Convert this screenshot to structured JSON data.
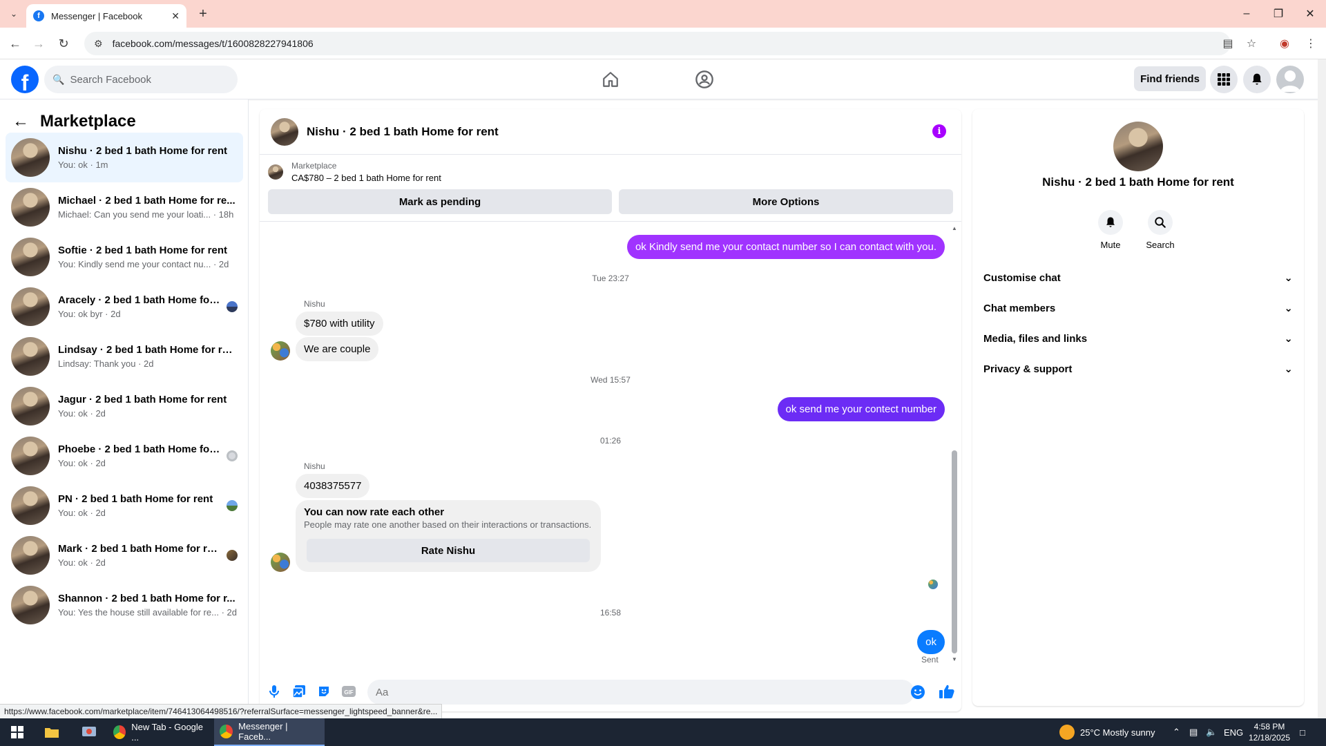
{
  "browser": {
    "tab_title": "Messenger | Facebook",
    "url": "facebook.com/messages/t/1600828227941806",
    "status_url": "https://www.facebook.com/marketplace/item/746413064498516/?referralSurface=messenger_lightspeed_banner&re..."
  },
  "fbnav": {
    "search_placeholder": "Search Facebook",
    "find_friends": "Find friends",
    "brand_color": "#0866ff"
  },
  "sidebar": {
    "title": "Marketplace",
    "conversations": [
      {
        "name": "Nishu · 2 bed 1 bath Home for rent",
        "preview": "You: ok · 1m"
      },
      {
        "name": "Michael · 2 bed 1 bath Home for re...",
        "preview": "Michael: Can you send me your loati... · 18h"
      },
      {
        "name": "Softie · 2 bed 1 bath Home for rent",
        "preview": "You: Kindly send me your contact nu... · 2d"
      },
      {
        "name": "Aracely · 2 bed 1 bath Home for ...",
        "preview": "You: ok byr · 2d"
      },
      {
        "name": "Lindsay · 2 bed 1 bath Home for rent",
        "preview": "Lindsay: Thank you · 2d"
      },
      {
        "name": "Jagur · 2 bed 1 bath Home for rent",
        "preview": "You: ok · 2d"
      },
      {
        "name": "Phoebe · 2 bed 1 bath Home for...",
        "preview": "You: ok · 2d"
      },
      {
        "name": "PN · 2 bed 1 bath Home for rent",
        "preview": "You: ok · 2d"
      },
      {
        "name": "Mark · 2 bed 1 bath Home for rent",
        "preview": "You: ok · 2d"
      },
      {
        "name": "Shannon · 2 bed 1 bath Home for r...",
        "preview": "You: Yes the house still available for re... · 2d"
      }
    ]
  },
  "chat": {
    "title": "Nishu · 2 bed 1 bath Home for rent",
    "listing_label": "Marketplace",
    "listing_detail": "CA$780 – 2 bed 1 bath Home for rent",
    "mark_pending": "Mark as pending",
    "more_options": "More Options",
    "msg1": "ok Kindly  send me your contact number so I can contact with you.",
    "ts1": "Tue 23:27",
    "sender1": "Nishu",
    "msg2": "$780 with utility",
    "msg3": "We are couple",
    "ts2": "Wed 15:57",
    "msg4": "ok send me your contect number",
    "ts3": "01:26",
    "sender2": "Nishu",
    "msg5": "4038375577",
    "rate_title": "You can now rate each other",
    "rate_sub": "People may rate one another based on their interactions or transactions.",
    "rate_button": "Rate Nishu",
    "ts4": "16:58",
    "msg6": "ok",
    "sent": "Sent",
    "composer_placeholder": "Aa",
    "out_color_1": "#a033ff",
    "out_color_2": "#6c2cf5",
    "out_color_3": "#0a7cff"
  },
  "info": {
    "name": "Nishu · 2 bed 1 bath Home for rent",
    "mute": "Mute",
    "search": "Search",
    "rows": [
      "Customise chat",
      "Chat members",
      "Media, files and links",
      "Privacy & support"
    ]
  },
  "taskbar": {
    "item1": "New Tab - Google ...",
    "item2": "Messenger | Faceb...",
    "weather": "25°C  Mostly sunny",
    "lang": "ENG",
    "time": "4:58 PM",
    "date": "12/18/2025"
  }
}
